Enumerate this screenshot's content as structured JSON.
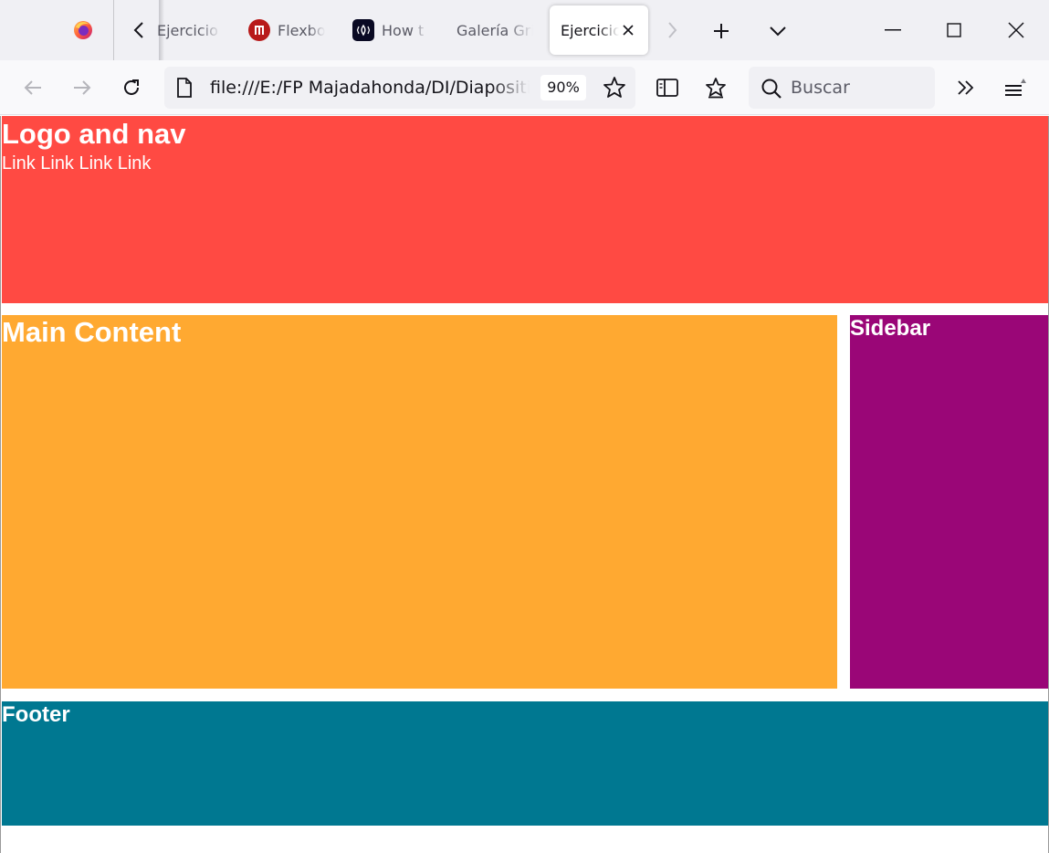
{
  "browser": {
    "tabs": [
      {
        "label": "Ejercicio G",
        "icon": "back-page-icon",
        "active": false
      },
      {
        "label": "Flexbo",
        "icon": "flexbox-site-icon",
        "active": false
      },
      {
        "label": "How t",
        "icon": "freecodecamp-icon",
        "active": false
      },
      {
        "label": "Galería Gri",
        "icon": "none",
        "active": false
      },
      {
        "label": "Ejercicio",
        "icon": "none",
        "active": true
      }
    ],
    "url": "file:///E:/FP Majadahonda/DI/Diapositivas",
    "zoom": "90%",
    "search_placeholder": "Buscar"
  },
  "page": {
    "header": {
      "title": "Logo and nav",
      "links": "Link Link Link Link"
    },
    "main": {
      "title": "Main Content"
    },
    "sidebar": {
      "title": "Sidebar"
    },
    "footer": {
      "title": "Footer"
    }
  },
  "colors": {
    "header": "#ff4a43",
    "main": "#ffa931",
    "sidebar": "#9a0677",
    "footer": "#007891"
  }
}
